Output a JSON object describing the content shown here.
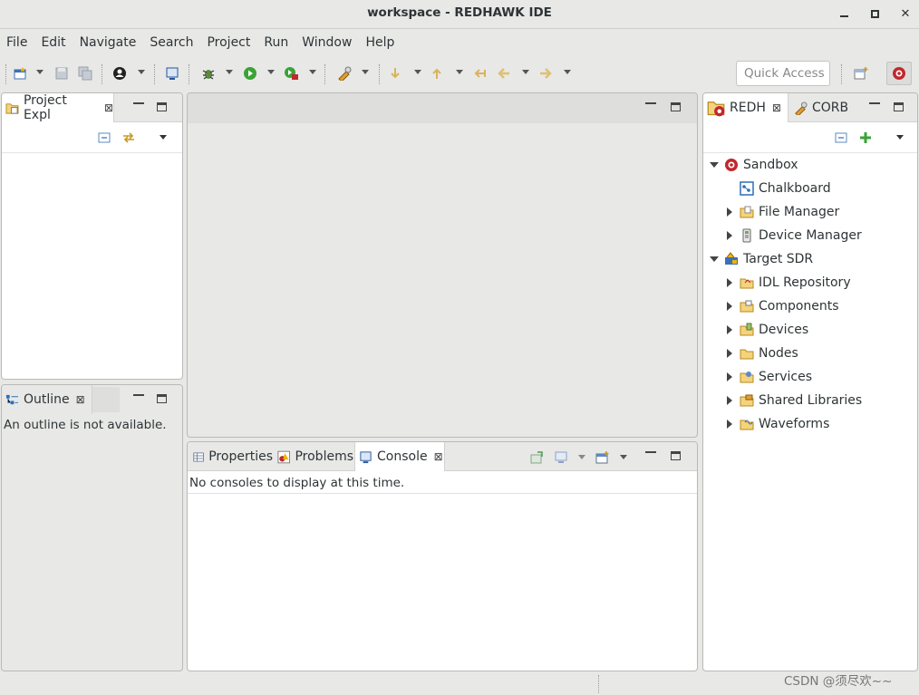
{
  "window": {
    "title": "workspace - REDHAWK IDE",
    "min": "—",
    "max": "□",
    "close": "✕"
  },
  "menu": [
    "File",
    "Edit",
    "Navigate",
    "Search",
    "Project",
    "Run",
    "Window",
    "Help"
  ],
  "quick_access": {
    "placeholder": "Quick Access"
  },
  "project_explorer": {
    "tab": "Project Expl"
  },
  "outline": {
    "tab": "Outline",
    "message": "An outline is not available."
  },
  "bottom_panel": {
    "tabs": [
      "Properties",
      "Problems",
      "Console"
    ],
    "active": "Console",
    "message": "No consoles to display at this time."
  },
  "right_panel": {
    "tabs": [
      "REDH",
      "CORB"
    ],
    "active": "REDH"
  },
  "tree": [
    {
      "label": "Sandbox",
      "expanded": true,
      "level": 0,
      "icon": "redhawk-sandbox-icon"
    },
    {
      "label": "Chalkboard",
      "level": 1,
      "leaf": true,
      "icon": "chalkboard-icon"
    },
    {
      "label": "File Manager",
      "level": 1,
      "icon": "file-manager-icon"
    },
    {
      "label": "Device Manager",
      "level": 1,
      "icon": "device-manager-icon"
    },
    {
      "label": "Target SDR",
      "expanded": true,
      "level": 0,
      "icon": "target-sdr-icon"
    },
    {
      "label": "IDL Repository",
      "level": 1,
      "icon": "folder-icon"
    },
    {
      "label": "Components",
      "level": 1,
      "icon": "folder-icon"
    },
    {
      "label": "Devices",
      "level": 1,
      "icon": "folder-icon"
    },
    {
      "label": "Nodes",
      "level": 1,
      "icon": "folder-icon"
    },
    {
      "label": "Services",
      "level": 1,
      "icon": "folder-icon"
    },
    {
      "label": "Shared Libraries",
      "level": 1,
      "icon": "folder-icon"
    },
    {
      "label": "Waveforms",
      "level": 1,
      "icon": "folder-icon"
    }
  ],
  "watermark": "CSDN @须尽欢~~",
  "colors": {
    "accent": "#1e5fb4",
    "redhawk": "#c0282d",
    "run": "#3aa335",
    "folder": "#f4d37c"
  }
}
